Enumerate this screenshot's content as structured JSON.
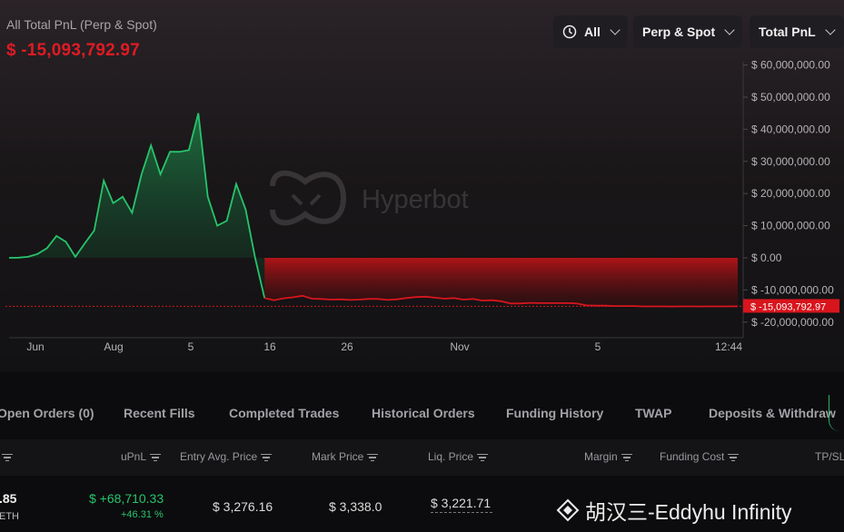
{
  "header": {
    "title": "All Total PnL (Perp & Spot)",
    "value": "$ -15,093,792.97"
  },
  "controls": {
    "period": "All",
    "market": "Perp & Spot",
    "metric": "Total PnL"
  },
  "chart_data": {
    "type": "area",
    "title": "All Total PnL (Perp & Spot)",
    "x_ticks": [
      "Jun",
      "Aug",
      "5",
      "16",
      "26",
      "Nov",
      "5",
      "12:44"
    ],
    "y_ticks": [
      "$ 60,000,000.00",
      "$ 50,000,000.00",
      "$ 40,000,000.00",
      "$ 30,000,000.00",
      "$ 20,000,000.00",
      "$ 10,000,000.00",
      "$ 0.00",
      "$ -10,000,000.00",
      "$ -20,000,000.00"
    ],
    "ylim": [
      -22000000,
      62000000
    ],
    "current_label": "$ -15,093,792.97",
    "current_value": -15093792.97,
    "watermark": "Hyperbot",
    "colors": {
      "positive": "#27c46b",
      "negative": "#d8151d"
    },
    "series": [
      {
        "values": [
          0,
          50000,
          300000,
          1200000,
          3000000,
          6800000,
          5000000,
          300000,
          4500000,
          8500000,
          24000000,
          17000000,
          19000000,
          14000000,
          26000000,
          35000000,
          26000000,
          33000000,
          33000000,
          33500000,
          45000000,
          19000000,
          10000000,
          11500000,
          23000000,
          15000000,
          0,
          -12500000,
          -13200000,
          -12600000,
          -12300000,
          -11800000,
          -12700000,
          -12800000,
          -13000000,
          -12900000,
          -13100000,
          -13000000,
          -12800000,
          -12800000,
          -13100000,
          -12900000,
          -12500000,
          -12200000,
          -12100000,
          -12400000,
          -12700000,
          -12500000,
          -13000000,
          -12800000,
          -13300000,
          -13200000,
          -13500000,
          -14200000,
          -14200000,
          -14000000,
          -14100000,
          -14100000,
          -14100000,
          -14100000,
          -14200000,
          -14800000,
          -14900000,
          -14900000,
          -15000000,
          -15000000,
          -15000000,
          -15100000,
          -15100000,
          -15100000,
          -15150000,
          -15100000,
          -15100000,
          -15150000,
          -15100000,
          -15120000,
          -15100000,
          -15093792.97
        ]
      }
    ]
  },
  "tabs": [
    "Open Orders (0)",
    "Recent Fills",
    "Completed Trades",
    "Historical Orders",
    "Funding History",
    "TWAP",
    "Deposits & Withdraw"
  ],
  "table": {
    "columns": [
      "uPnL",
      "Entry Avg. Price",
      "Mark Price",
      "Liq. Price",
      "Margin",
      "Funding Cost",
      "TP/SL"
    ],
    "row": {
      "size": ".85",
      "asset": "ETH",
      "upnl": "$ +68,710.33",
      "upnl_pct": "+46.31 %",
      "entry": "$ 3,276.16",
      "mark": "$ 3,338.0",
      "liq": "$ 3,221.71"
    }
  },
  "watermark_text": "胡汉三-Eddyhu Infinity"
}
